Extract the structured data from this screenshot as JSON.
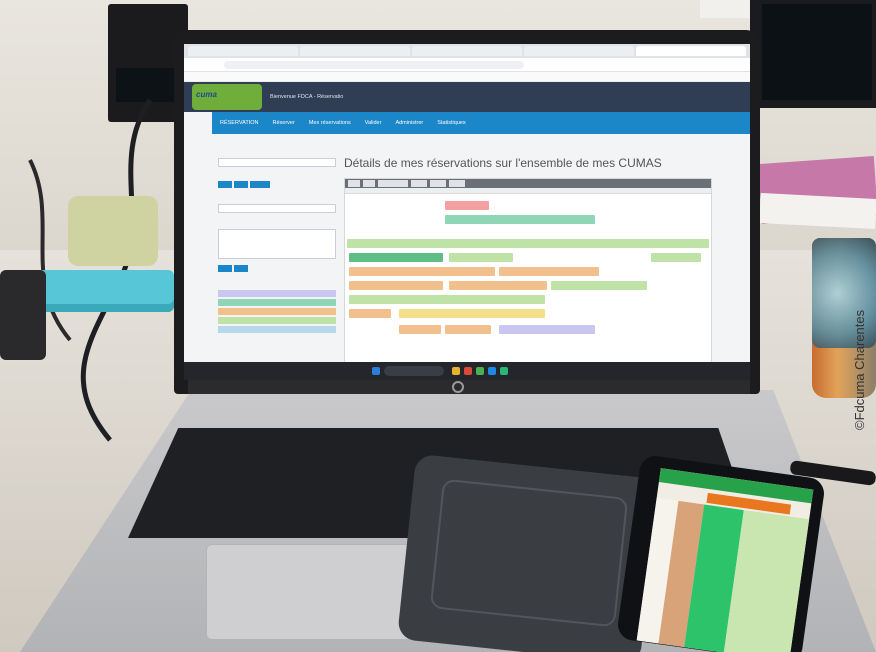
{
  "photo": {
    "credit": "©Fdcuma Charentes",
    "page_title": "Détails de mes réservations sur l'ensemble de mes CUMAS",
    "site_welcome": "Bienvenue FDCA - Réservatio",
    "nav": [
      "RÉSERVATION",
      "Réserver",
      "Mes réservations",
      "Valider",
      "Administrer",
      "Statistiques"
    ],
    "colors": {
      "site_header": "#2f3e55",
      "nav_bar": "#1b86c8",
      "event_green": "#bfe3a7",
      "event_orange": "#f1c08c",
      "event_teal": "#8fd6b6",
      "event_lavender": "#c9c6f0"
    }
  }
}
